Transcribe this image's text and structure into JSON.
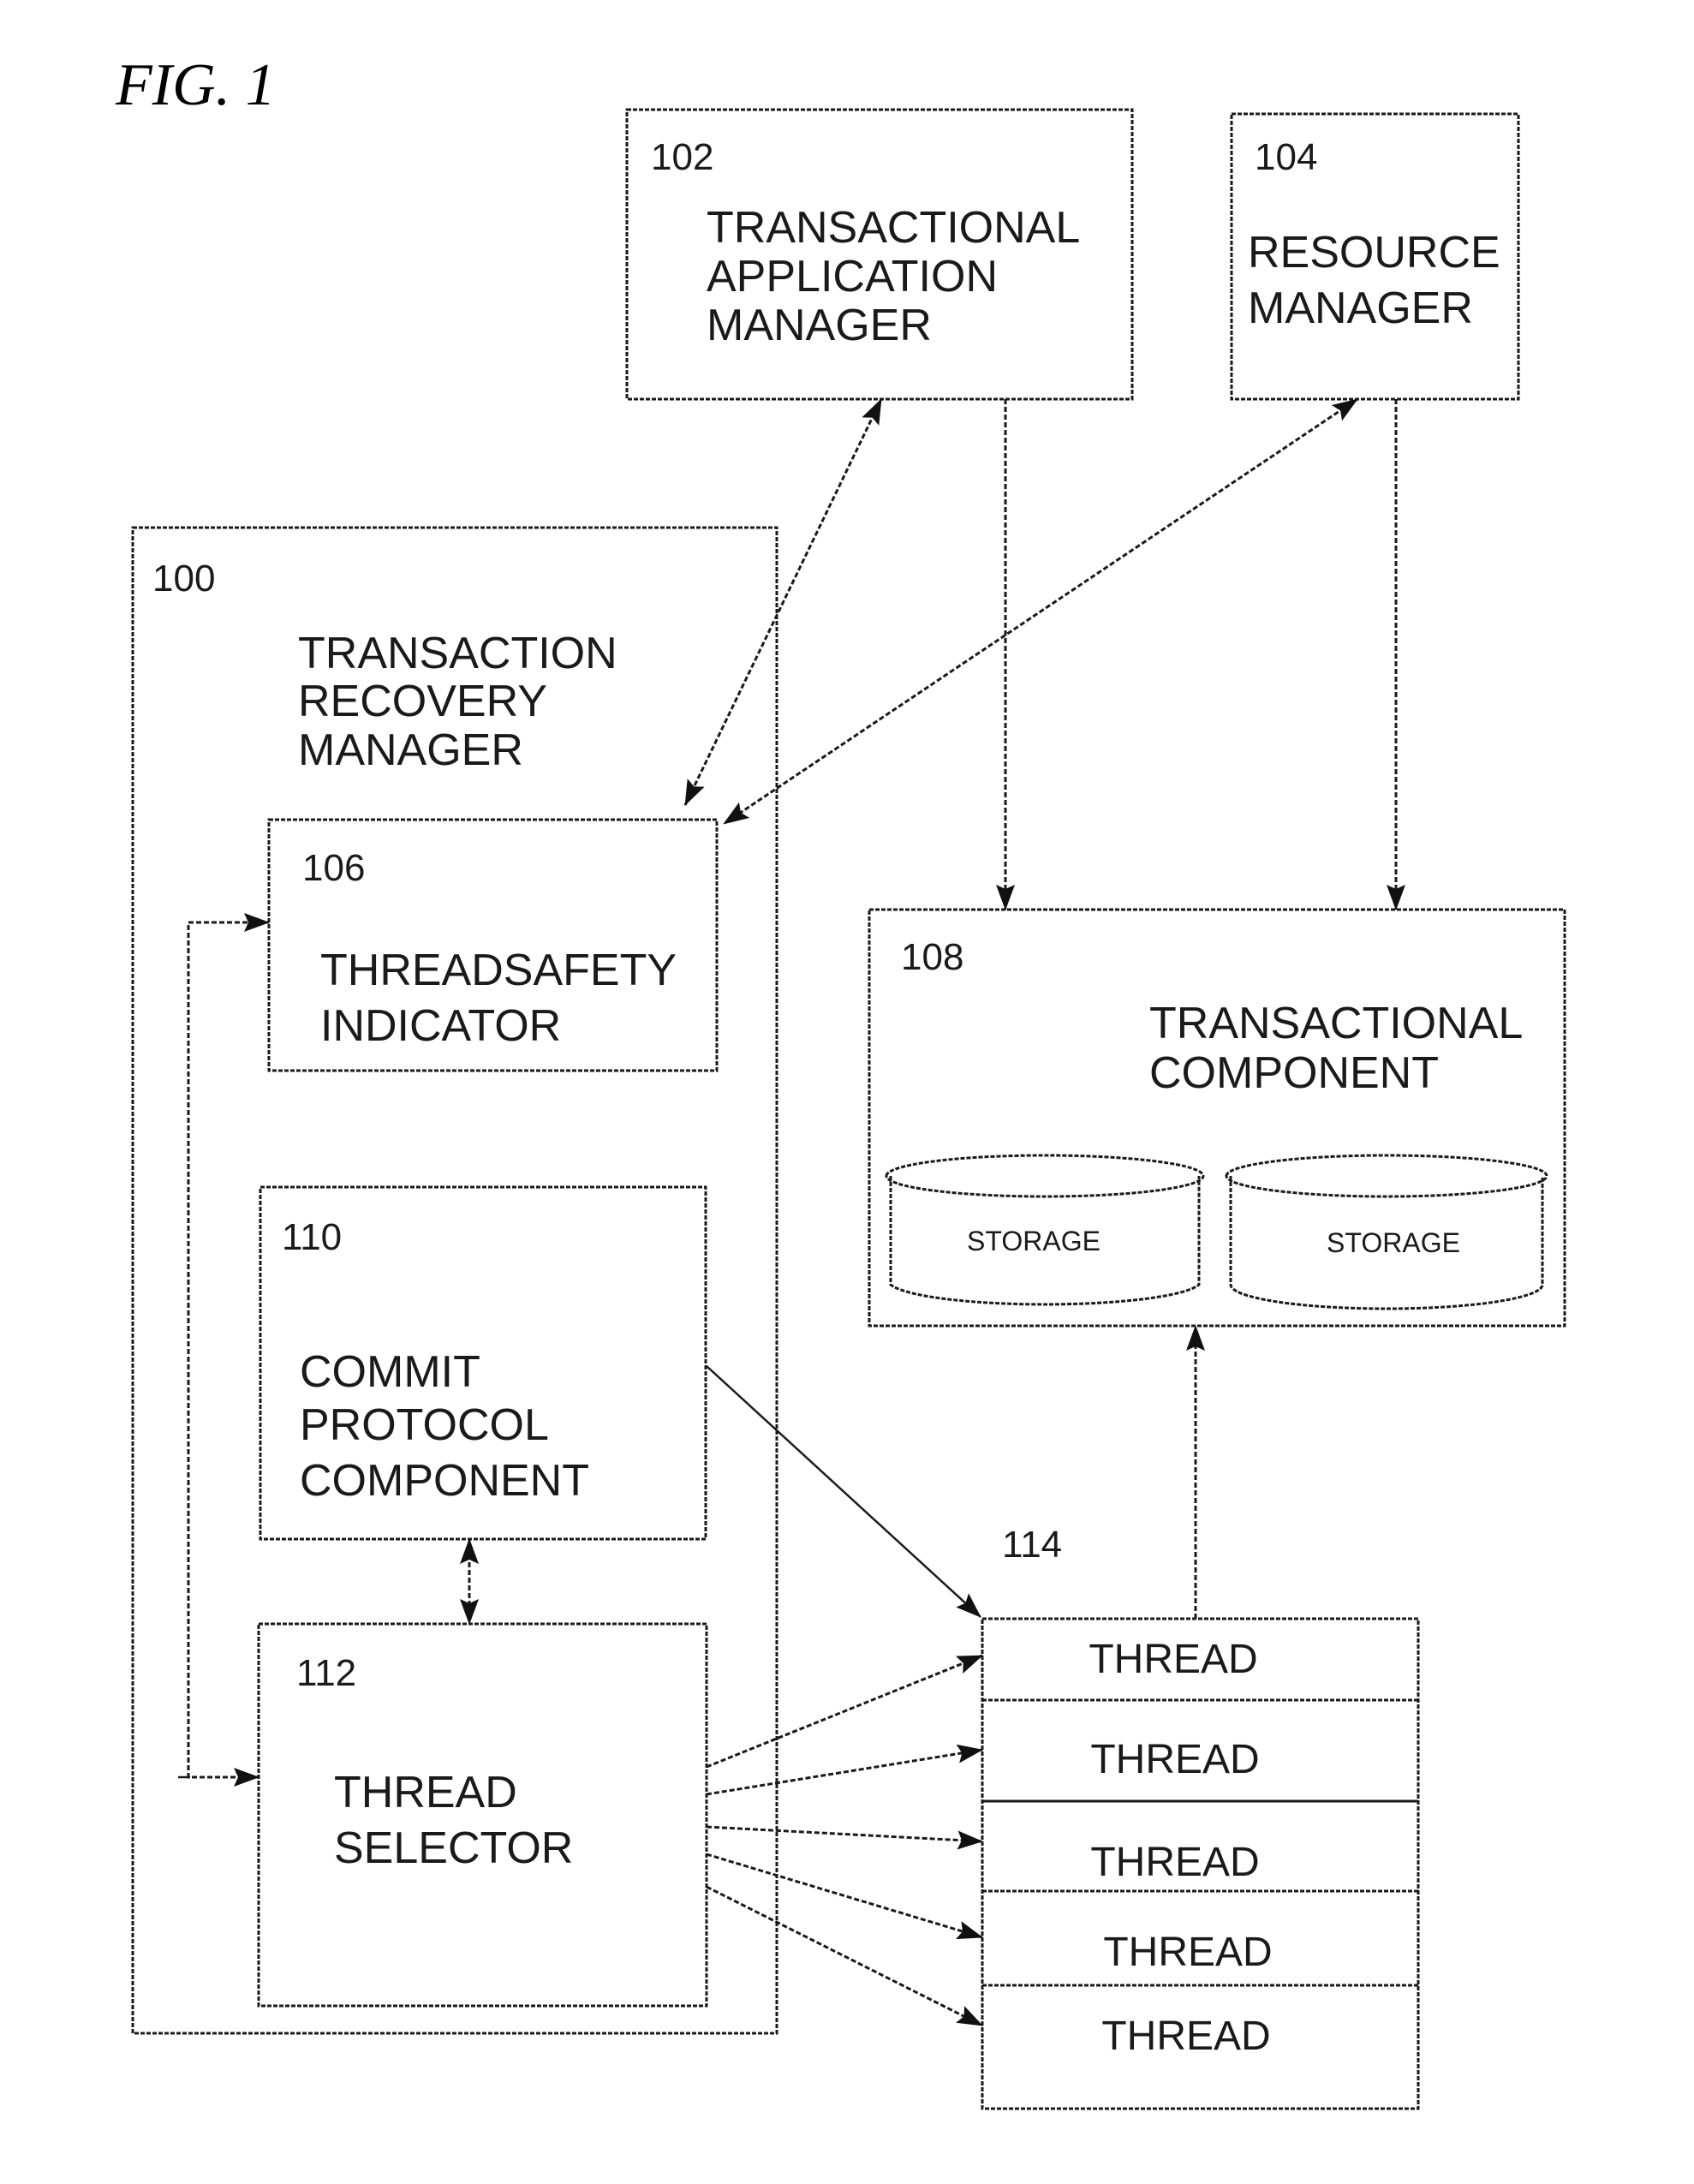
{
  "figure": {
    "title": "FIG. 1"
  },
  "nodes": {
    "transactional_application_manager": {
      "ref": "102",
      "lines": [
        "TRANSACTIONAL",
        "APPLICATION",
        "MANAGER"
      ]
    },
    "resource_manager": {
      "ref": "104",
      "lines": [
        "RESOURCE",
        "MANAGER"
      ]
    },
    "transaction_recovery_manager": {
      "ref": "100",
      "lines": [
        "TRANSACTION",
        "RECOVERY",
        "MANAGER"
      ]
    },
    "threadsafety_indicator": {
      "ref": "106",
      "lines": [
        "THREADSAFETY",
        "INDICATOR"
      ]
    },
    "transactional_component": {
      "ref": "108",
      "lines": [
        "TRANSACTIONAL",
        "COMPONENT"
      ],
      "storage": [
        "STORAGE",
        "STORAGE"
      ]
    },
    "commit_protocol_component": {
      "ref": "110",
      "lines": [
        "COMMIT",
        "PROTOCOL",
        "COMPONENT"
      ]
    },
    "thread_selector": {
      "ref": "112",
      "lines": [
        "THREAD",
        "SELECTOR"
      ]
    },
    "thread_pool": {
      "ref": "114",
      "threads": [
        "THREAD",
        "THREAD",
        "THREAD",
        "THREAD",
        "THREAD"
      ]
    }
  },
  "edges": [
    {
      "from": "102",
      "to": "106",
      "direction": "bidirectional"
    },
    {
      "from": "104",
      "to": "106",
      "direction": "bidirectional"
    },
    {
      "from": "102",
      "to": "108",
      "direction": "forward"
    },
    {
      "from": "104",
      "to": "108",
      "direction": "forward"
    },
    {
      "from": "106",
      "to": "112",
      "direction": "bidirectional"
    },
    {
      "from": "110",
      "to": "112",
      "direction": "bidirectional"
    },
    {
      "from": "110",
      "to": "114",
      "direction": "forward"
    },
    {
      "from": "112",
      "to": "114.thread1",
      "direction": "forward"
    },
    {
      "from": "112",
      "to": "114.thread2",
      "direction": "forward"
    },
    {
      "from": "112",
      "to": "114.thread3",
      "direction": "forward"
    },
    {
      "from": "112",
      "to": "114.thread4",
      "direction": "forward"
    },
    {
      "from": "112",
      "to": "114.thread5",
      "direction": "forward"
    },
    {
      "from": "114",
      "to": "108",
      "direction": "forward"
    }
  ]
}
